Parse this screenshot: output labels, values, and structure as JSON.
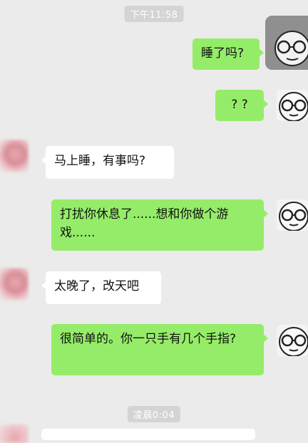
{
  "chat": {
    "timestamp_1": "下午11:58",
    "timestamp_2": "凌晨0:04",
    "messages": [
      {
        "from": "me",
        "text": "睡了吗?"
      },
      {
        "from": "me",
        "text": "? ?"
      },
      {
        "from": "other",
        "text": "马上睡，有事吗?"
      },
      {
        "from": "me",
        "text": "打扰你休息了......想和你做个游戏......"
      },
      {
        "from": "other",
        "text": "太晚了，改天吧"
      },
      {
        "from": "me",
        "text": "很简单的。你一只手有几个手指?"
      }
    ]
  },
  "icons": {
    "me_avatar": "cartoon-face-with-glasses-icon",
    "other_avatar": "blurred-avatar"
  },
  "colors": {
    "background": "#ebebeb",
    "my_bubble": "#95ec69",
    "other_bubble": "#ffffff",
    "timestamp_bg": "#d4d4d4"
  }
}
